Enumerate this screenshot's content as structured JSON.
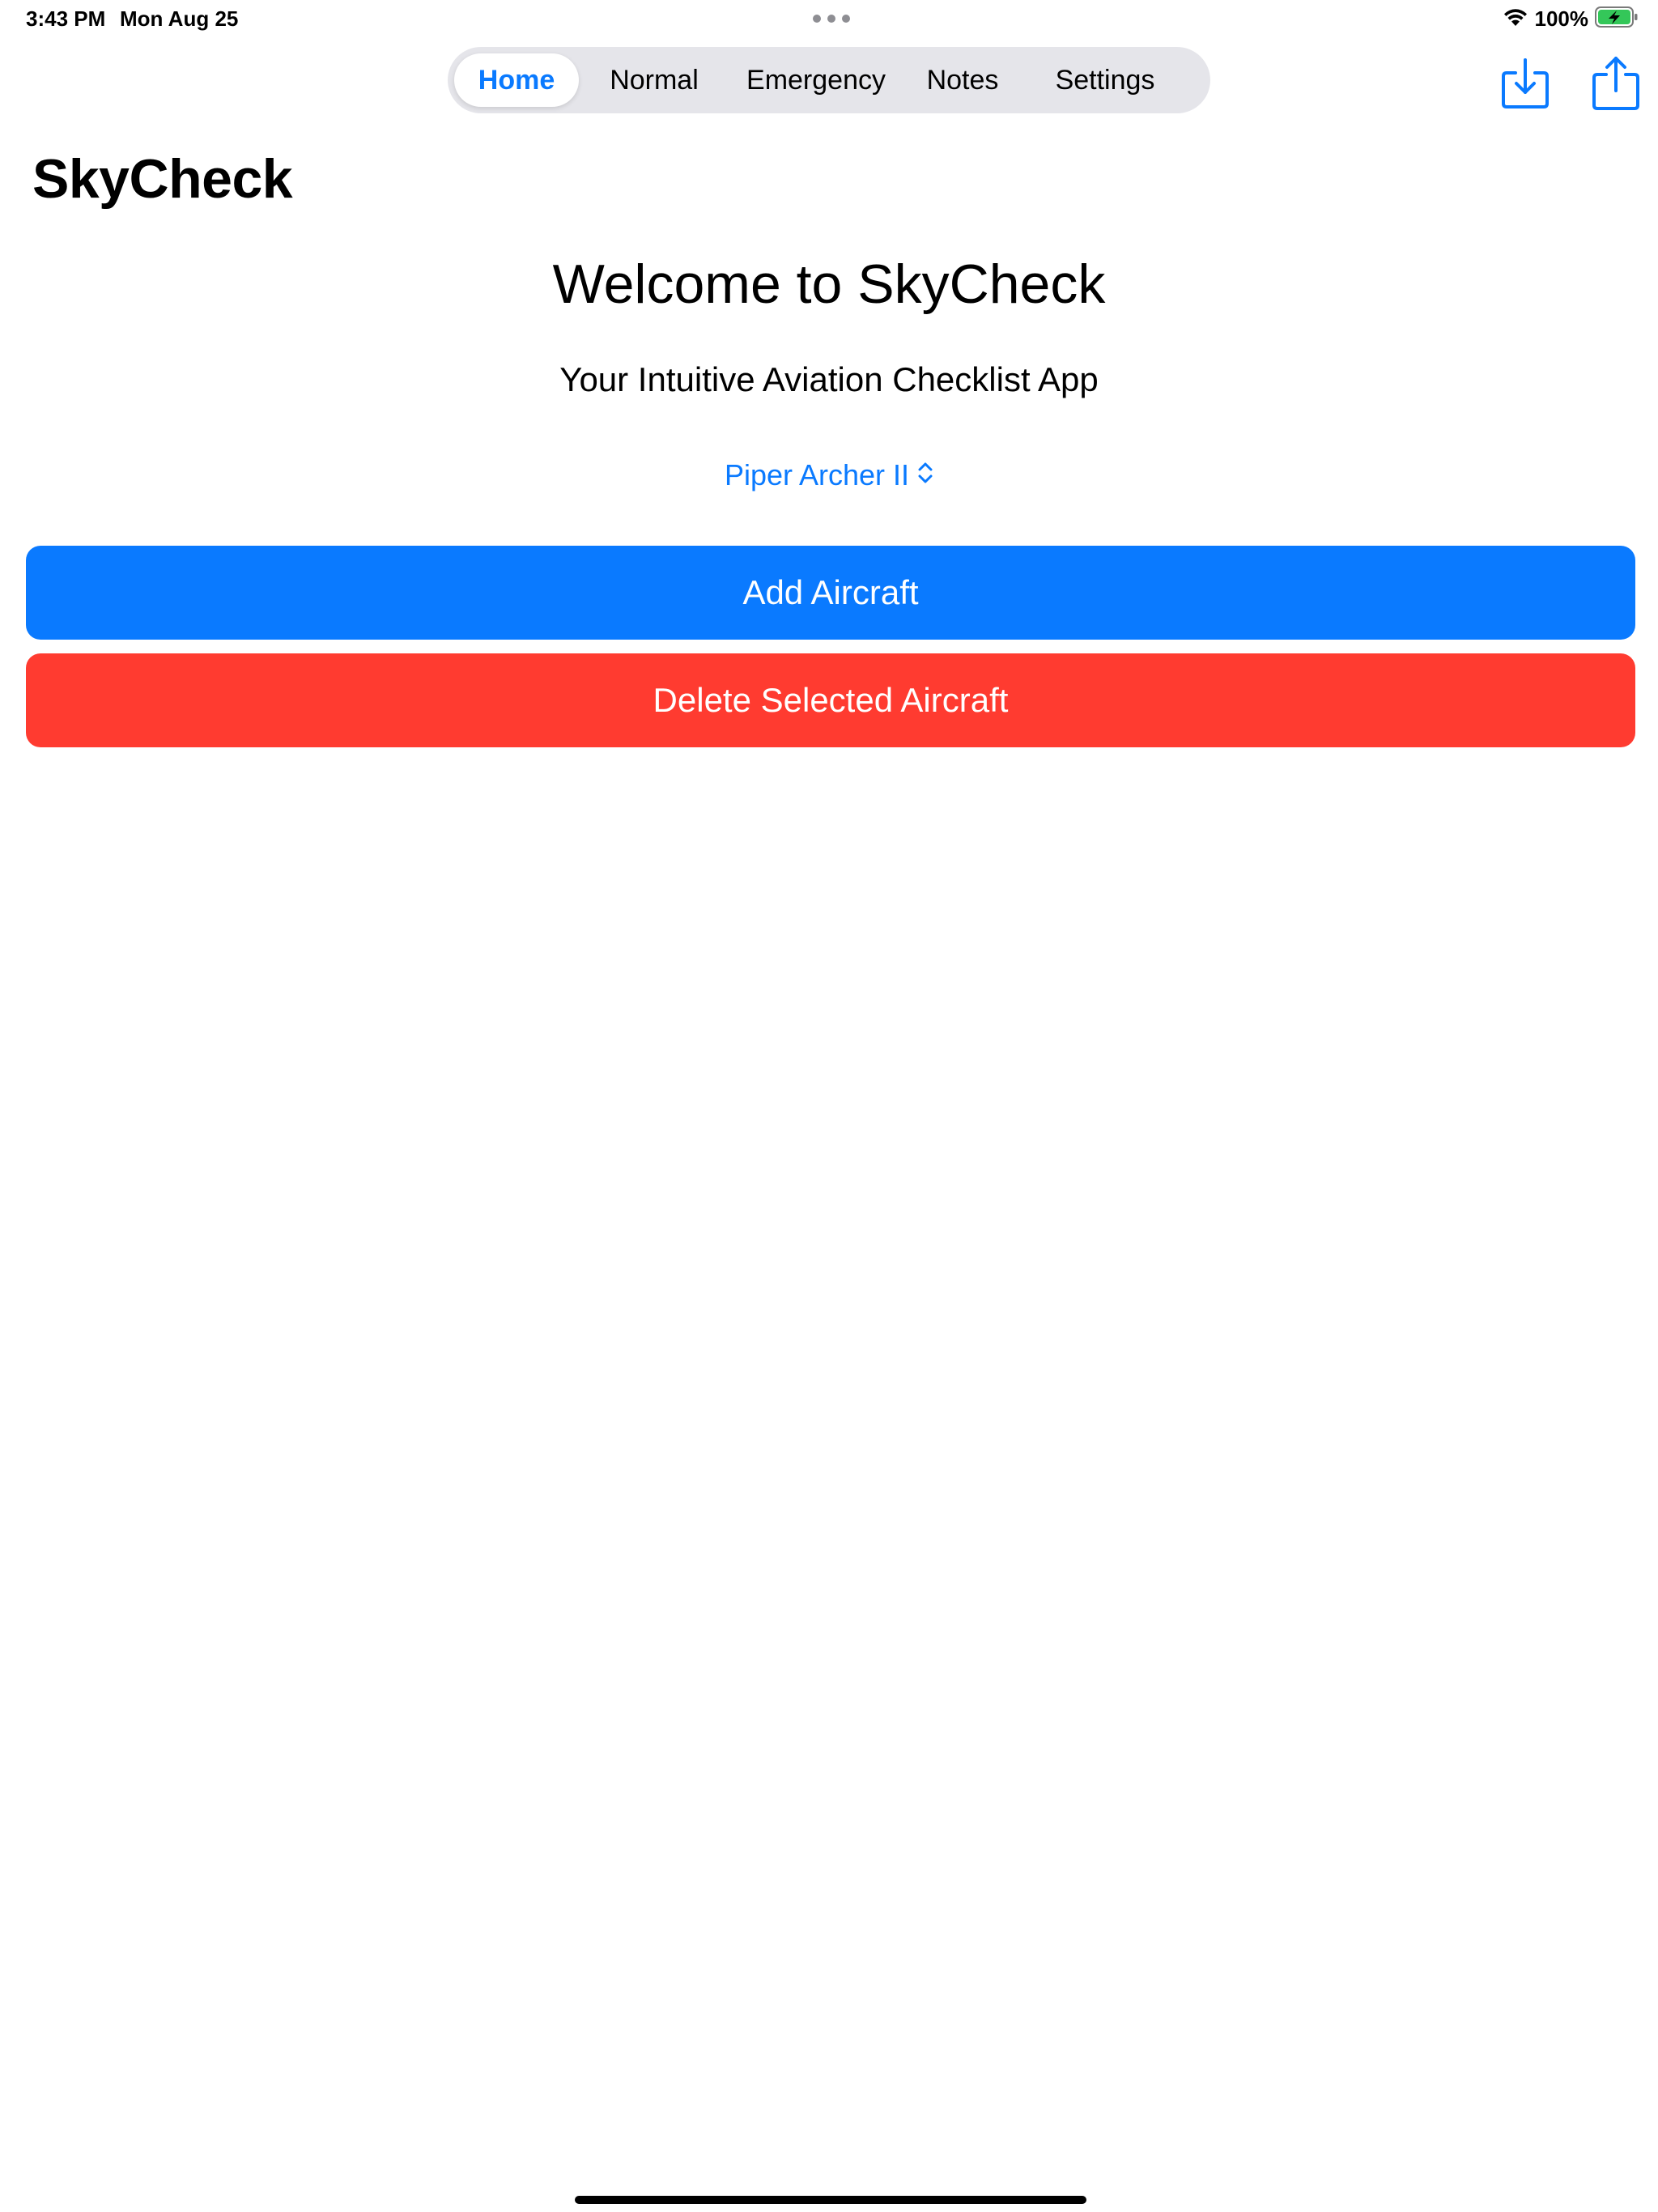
{
  "status_bar": {
    "time": "3:43 PM",
    "date": "Mon Aug 25",
    "battery_percent": "100%",
    "icons": [
      "wifi-icon",
      "battery-charging-icon"
    ]
  },
  "tabs": [
    {
      "label": "Home",
      "active": true
    },
    {
      "label": "Normal",
      "active": false
    },
    {
      "label": "Emergency",
      "active": false
    },
    {
      "label": "Notes",
      "active": false
    },
    {
      "label": "Settings",
      "active": false
    }
  ],
  "toolbar": {
    "icons": [
      "import-icon",
      "share-icon"
    ]
  },
  "page": {
    "title": "SkyCheck",
    "welcome": "Welcome to SkyCheck",
    "subtitle": "Your Intuitive Aviation Checklist App"
  },
  "aircraft_picker": {
    "selected": "Piper Archer II",
    "icon": "chevron-up-down-icon"
  },
  "buttons": {
    "add_aircraft": "Add Aircraft",
    "delete_selected": "Delete Selected Aircraft"
  },
  "colors": {
    "accent": "#0a7aff",
    "destructive": "#ff3b30",
    "segment_background": "#e5e5ea",
    "battery_fill": "#34c759"
  }
}
